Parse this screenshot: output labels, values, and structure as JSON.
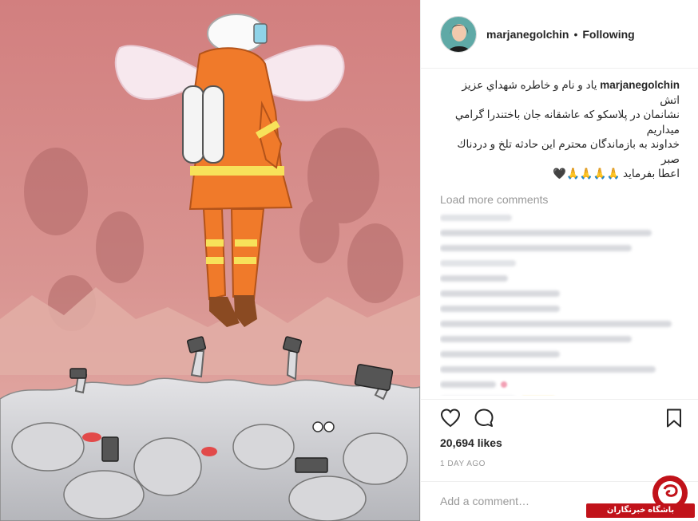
{
  "post": {
    "author": {
      "username": "marjanegolchin",
      "follow_state": "Following",
      "separator": "•",
      "avatar_icon": "profile-photo"
    },
    "caption": {
      "username": "marjanegolchin",
      "lines": [
        "ياد و نام و خاطره شهداي عزيز اتش",
        "نشانمان در پلاسكو كه عاشقانه جان باختندرا گرامي ميداريم",
        "خداوند به بازماندگان محترم اين حادثه تلخ و دردناك صبر",
        "اعطا بفرمايد 🙏🙏🙏🙏🖤"
      ]
    },
    "load_more_label": "Load more comments",
    "likes": "20,694 likes",
    "timestamp": "1 DAY AGO",
    "comment_placeholder": "Add a comment…",
    "icons": {
      "like": "heart-icon",
      "comment": "speech-bubble-icon",
      "save": "bookmark-icon"
    },
    "colors": {
      "image_background": "#d58e8c",
      "firefighter_suit": "#f07a2a",
      "reflective_stripe": "#f7e25a",
      "watermark_red": "#c1121a"
    }
  },
  "watermark": {
    "text": "باشگاه خبرنگاران"
  }
}
